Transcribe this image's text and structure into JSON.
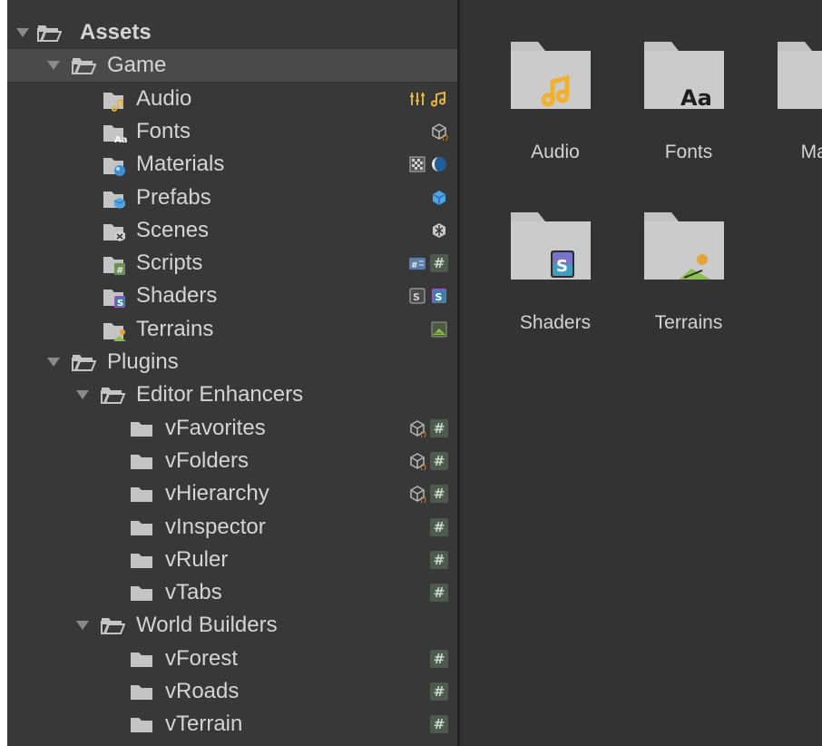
{
  "tree": {
    "root": {
      "label": "Assets"
    },
    "game": {
      "label": "Game",
      "children": [
        {
          "label": "Audio",
          "icon": "audio-folder-icon",
          "badges": [
            "audio-mixer-icon",
            "music-note-icon"
          ]
        },
        {
          "label": "Fonts",
          "icon": "fonts-folder-icon",
          "badges": [
            "package-icon"
          ]
        },
        {
          "label": "Materials",
          "icon": "materials-folder-icon",
          "badges": [
            "texture-icon",
            "material-sphere-icon"
          ]
        },
        {
          "label": "Prefabs",
          "icon": "prefabs-folder-icon",
          "badges": [
            "prefab-cube-icon"
          ]
        },
        {
          "label": "Scenes",
          "icon": "scenes-folder-icon",
          "badges": [
            "unity-scene-icon"
          ]
        },
        {
          "label": "Scripts",
          "icon": "scripts-folder-icon",
          "badges": [
            "assembly-icon",
            "csharp-script-icon"
          ]
        },
        {
          "label": "Shaders",
          "icon": "shaders-folder-icon",
          "badges": [
            "shader-graph-icon",
            "shader-icon"
          ]
        },
        {
          "label": "Terrains",
          "icon": "terrains-folder-icon",
          "badges": [
            "terrain-icon"
          ]
        }
      ]
    },
    "plugins": {
      "label": "Plugins",
      "editor_enhancers": {
        "label": "Editor Enhancers",
        "children": [
          {
            "label": "vFavorites",
            "badges": [
              "package-icon",
              "csharp-script-icon"
            ]
          },
          {
            "label": "vFolders",
            "badges": [
              "package-icon",
              "csharp-script-icon"
            ]
          },
          {
            "label": "vHierarchy",
            "badges": [
              "package-icon",
              "csharp-script-icon"
            ]
          },
          {
            "label": "vInspector",
            "badges": [
              "csharp-script-icon"
            ]
          },
          {
            "label": "vRuler",
            "badges": [
              "csharp-script-icon"
            ]
          },
          {
            "label": "vTabs",
            "badges": [
              "csharp-script-icon"
            ]
          }
        ]
      },
      "world_builders": {
        "label": "World Builders",
        "children": [
          {
            "label": "vForest",
            "badges": [
              "csharp-script-icon"
            ]
          },
          {
            "label": "vRoads",
            "badges": [
              "csharp-script-icon"
            ]
          },
          {
            "label": "vTerrain",
            "badges": [
              "csharp-script-icon"
            ]
          }
        ]
      }
    },
    "hash_glyph": "#",
    "colors": {
      "selected_row": "#4a4a4a",
      "panel": "#383838",
      "grid": "#333333"
    }
  },
  "grid": {
    "tiles": [
      {
        "label": "Audio",
        "overlay": "music-note-icon"
      },
      {
        "label": "Fonts",
        "overlay": "font-aa-icon",
        "overlay_text": "Aa"
      },
      {
        "label": "Mate",
        "overlay": "none"
      },
      {
        "label": "Shaders",
        "overlay": "shader-icon",
        "overlay_text": "S"
      },
      {
        "label": "Terrains",
        "overlay": "terrain-icon"
      }
    ]
  }
}
